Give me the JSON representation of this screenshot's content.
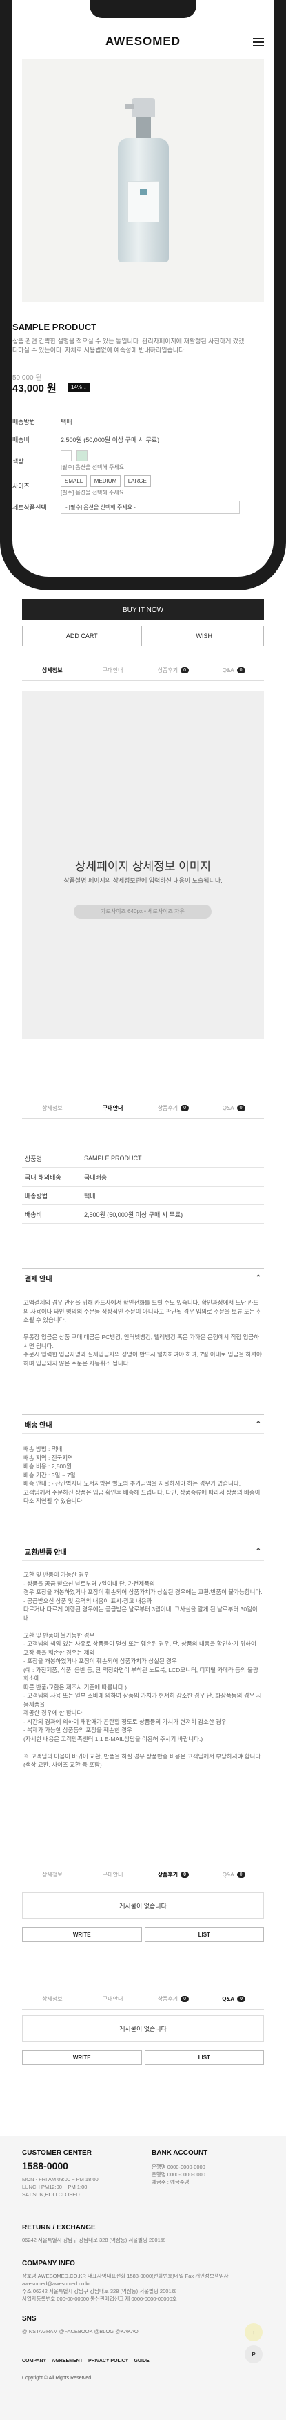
{
  "header": {
    "logo": "AWESOMED"
  },
  "product": {
    "name": "SAMPLE PRODUCT",
    "description": "상품 관련 간략한 설명을 적으실 수 있는 통입니다. 관리자페이지에 재활정된 사진하게 갔겠다하실 수 있는이다. 자체로 시용법없에 예속성에 반내하라입습니다.",
    "price_old": "50,000 원",
    "price": "43,000 원",
    "discount": "14% ↓"
  },
  "options": {
    "shipping_fee_label": "배송방법",
    "shipping_method": "택배",
    "fee_label": "배송비",
    "fee": "2,500원 (50,000원 이상 구매 시 무료)",
    "color_label": "색상",
    "color_select": "[필수] 옵션을 선택해 주세요",
    "size_label": "사이즈",
    "sizes": [
      "SMALL",
      "MEDIUM",
      "LARGE"
    ],
    "size_select": "[필수] 옵션을 선택해 주세요",
    "set_label": "세트상품선택",
    "set_select": "- [필수] 옵션을 선택해 주세요 -"
  },
  "actions": {
    "buy": "BUY IT NOW",
    "cart": "ADD CART",
    "wish": "WISH"
  },
  "tabs": [
    {
      "label": "상세정보"
    },
    {
      "label": "구매안내"
    },
    {
      "label": "상품후기",
      "count": "0"
    },
    {
      "label": "Q&A",
      "count": "0"
    }
  ],
  "detail": {
    "title": "상세페이지 상세정보 이미지",
    "subtitle": "상품설명 페이지의 상세정보란에 입력하신 내용이 노출됩니다.",
    "size_hint": "가로사이즈 640px • 세로사이즈 자유"
  },
  "info_table": [
    {
      "k": "상품명",
      "v": "SAMPLE PRODUCT"
    },
    {
      "k": "국내·해외배송",
      "v": "국내배송"
    },
    {
      "k": "배송방법",
      "v": "택배"
    },
    {
      "k": "배송비",
      "v": "2,500원 (50,000원 이상 구매 시 무료)"
    }
  ],
  "sections": {
    "payment_title": "결제 안내",
    "payment_body": "고액결제의 경우 안전을 위해 카드사에서 확인전화를 드릴 수도 있습니다. 확인과정에서 도난 카드의 사용이나 타인 명의의 주문등 정상적인 주문이 아니라고 판단될 경우 임의로 주문을 보류 또는 취소될 수 있습니다.\n\n무통장 입금은 상품 구매 대금은 PC뱅킹, 인터넷뱅킹, 텔레뱅킹 혹은 가까운 은행에서 직접 입금하시면 됩니다.\n주문시 입력한 입금자명과 실제입금자의 성명이 반드시 일치하여야 하며, 7일 이내로 입금을 하셔야 하며 입금되지 않은 주문은 자동취소 됩니다.",
    "delivery_title": "배송 안내",
    "delivery_body": "배송 방법 : 택배\n배송 지역 : 전국지역\n배송 비용 : 2,500원\n배송 기간 : 3일 ~ 7일\n배송 안내 : - 산간벽지나 도서지방은 별도의 추가금액을 지불하셔야 하는 경우가 있습니다.\n고객님께서 주문하신 상품은 입금 확인후 배송해 드립니다. 다만, 상품종류에 따라서 상품의 배송이 다소 지연될 수 있습니다.",
    "exchange_title": "교환/반품 안내",
    "exchange_body": "교환 및 반품이 가능한 경우\n- 상품을 공급 받으신 날로부터 7일이내 단, 가전제품의\n  경우 포장을 개봉하였거나 포장이 훼손되어 상품가치가 상실된 경우에는 교환/반품이 불가능합니다.\n- 공급받으신 상품 및 용역의 내용이 표시·광고 내용과\n  다르거나 다르게 이행된 경우에는 공급받은 날로부터 3월이내, 그사실을 알게 된 날로부터 30일이내\n\n교환 및 반품이 불가능한 경우\n- 고객님의 책임 있는 사유로 상품등이 멸실 또는 훼손된 경우. 단, 상품의 내용을 확인하기 위하여\n  포장 등을 훼손한 경우는 제외\n- 포장을 개봉하였거나 포장이 훼손되어 상품가치가 상실된 경우\n  (예 : 가전제품, 식품, 음반 등, 단 액정화면이 부착된 노트북, LCD모니터, 디지털 카메라 등의 불량화소에\n  따른 반품/교환은 제조사 기준에 따릅니다.)\n- 고객님의 사용 또는 일부 소비에 의하여 상품의 가치가 현저히 감소한 경우 단, 화장품등의 경우 시용제품을\n  제공한 경우에 한 합니다.\n- 시간의 경과에 의하여 재판매가 곤란할 정도로 상품등의 가치가 현저히 감소한 경우\n- 복제가 가능한 상품등의 포장을 훼손한 경우\n  (자세한 내용은 고객만족센터 1:1 E-MAIL상담을 이용해 주시기 바랍니다.)\n\n※ 고객님의 마음이 바뀌어 교환, 반품을 하실 경우 상품반송 비용은 고객님께서 부담하셔야 합니다.\n  (색상 교환, 사이즈 교환 등 포함)"
  },
  "boards": {
    "empty": "게시물이 없습니다",
    "write": "WRITE",
    "list": "LIST"
  },
  "footer": {
    "cs_title": "CUSTOMER CENTER",
    "cs_phone": "1588-0000",
    "cs_hours": "MON - FRI AM 09:00 ~ PM 18:00\nLUNCH PM12:00 ~ PM 1:00\nSAT,SUN,HOLI CLOSED",
    "bank_title": "BANK ACCOUNT",
    "bank_body": "은행명 0000-0000-0000\n은행명 0000-0000-0000\n예금주 : 예금주명",
    "return_title": "RETURN / EXCHANGE",
    "return_body": "06242 서울특별시 강남구 강남대로 328 (역삼동) 서울빌딩 2001호",
    "company_title": "COMPANY INFO",
    "company_body": "상호명 AWESOMED.CO.KR 대표자명대표전화 1588-0000(전화번호)메일 Fax 개인정보책임자\nawesomed@awesomed.co.kr\n주소 06242 서울특별시 강남구 강남대로 328 (역삼동) 서울빌딩 2001호\n사업자등록번호 000-00-00000 통신판매업신고 제 0000-0000-00000호",
    "sns_title": "SNS",
    "sns_body": "@INSTAGRAM  @FACEBOOK  @BLOG  @KAKAO",
    "links": [
      "COMPANY",
      "AGREEMENT",
      "PRIVACY POLICY",
      "GUIDE"
    ],
    "copyright": "Copyright © All Rights Reserved"
  },
  "colors": {
    "accent": "#222222",
    "float_up": "#f3f0c7",
    "float_p": "#e9e9e9"
  }
}
